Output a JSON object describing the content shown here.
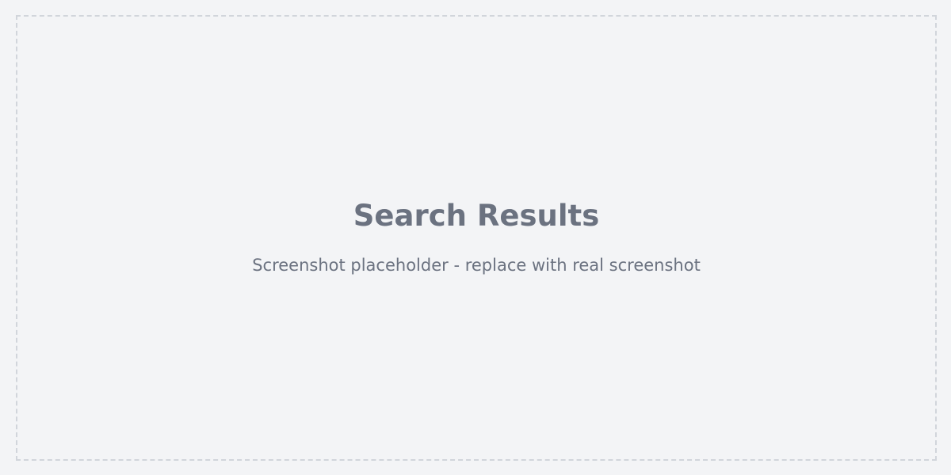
{
  "placeholder": {
    "title": "Search Results",
    "subtitle": "Screenshot placeholder - replace with real screenshot"
  },
  "colors": {
    "background": "#f3f4f6",
    "border": "#d1d5db",
    "text": "#6b7280"
  }
}
